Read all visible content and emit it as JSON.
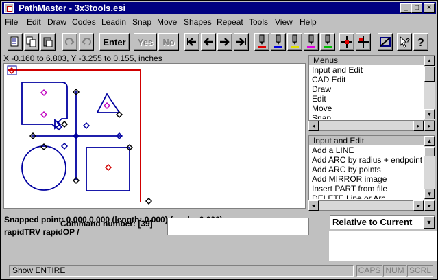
{
  "window": {
    "title": "PathMaster - 3x3tools.esi",
    "controls": [
      "_",
      "□",
      "×"
    ]
  },
  "menu": [
    "File",
    "Edit",
    "Draw",
    "Codes",
    "Leadin",
    "Snap",
    "Move",
    "Shapes",
    "Repeat",
    "Tools",
    "View",
    "Help"
  ],
  "toolbar": {
    "enter_label": "Enter",
    "yes_label": "Yes",
    "no_label": "No",
    "icons": [
      "new-doc-icon",
      "copy-icon",
      "paste-icon",
      "redo-icon",
      "undo-icon",
      "first-icon",
      "prev-icon",
      "next-icon",
      "last-icon",
      "tool-red-icon",
      "tool-blue-icon",
      "tool-yellow-icon",
      "tool-magenta-icon",
      "tool-green-icon",
      "move-origin-icon",
      "move-point-icon",
      "zoom-window-icon",
      "help-context-icon",
      "help-icon"
    ]
  },
  "coords_text": "X -0.160 to 6.803, Y -3.255 to 0.155, inches",
  "menus_panel": {
    "header": "Menus",
    "items": [
      "Input and Edit",
      "CAD Edit",
      "Draw",
      "Edit",
      "Move",
      "Snap"
    ]
  },
  "input_panel": {
    "header": "Input and Edit",
    "items": [
      "Add a LINE",
      "Add ARC by radius + endpoint",
      "Add ARC by points",
      "Add MIRROR image",
      "Insert PART from file",
      "DELETE Line or Arc"
    ]
  },
  "status": {
    "snapped": "Snapped point: 0.000,0.000  (length: 0.000) (angle: 0.000)",
    "rapid": "rapidTRV rapidOP /",
    "command_label": "Command number: [39]",
    "command_value": "",
    "relative_select": "Relative to Current"
  },
  "statusbar": {
    "message": "Show ENTIRE",
    "caps": "CAPS",
    "num": "NUM",
    "scrl": "SCRL"
  },
  "colors": {
    "titlebar": "#000080",
    "path_blue": "#0000a0",
    "boundary_red": "#d00000",
    "marker_magenta": "#c000c0"
  }
}
